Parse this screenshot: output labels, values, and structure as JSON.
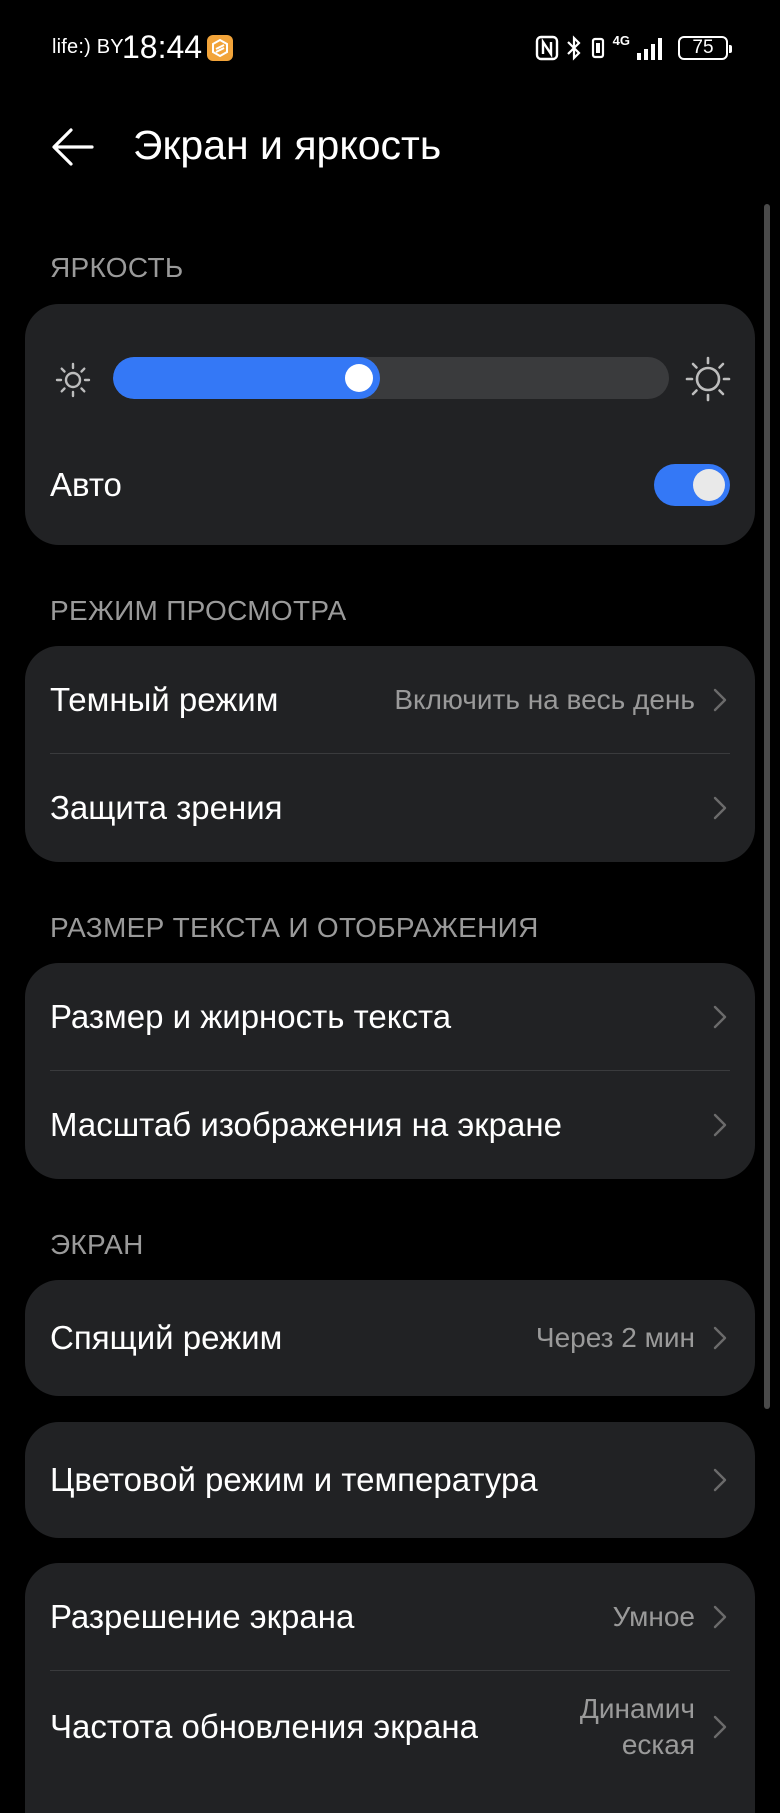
{
  "status_bar": {
    "carrier": "life:) BY",
    "time": "18:44",
    "network": "4G",
    "battery": "75"
  },
  "header": {
    "title": "Экран и яркость"
  },
  "brightness": {
    "section_title": "ЯРКОСТЬ",
    "level_percent": 48,
    "auto_label": "Авто",
    "auto_enabled": true
  },
  "view_mode": {
    "section_title": "РЕЖИМ ПРОСМОТРА",
    "items": [
      {
        "label": "Темный режим",
        "value": "Включить на весь день"
      },
      {
        "label": "Защита зрения",
        "value": ""
      }
    ]
  },
  "text_display": {
    "section_title": "РАЗМЕР ТЕКСТА И ОТОБРАЖЕНИЯ",
    "items": [
      {
        "label": "Размер и жирность текста"
      },
      {
        "label": "Масштаб изображения на экране"
      }
    ]
  },
  "screen": {
    "section_title": "ЭКРАН",
    "sleep": {
      "label": "Спящий режим",
      "value": "Через 2 мин"
    },
    "color": {
      "label": "Цветовой режим и температура"
    },
    "resolution": {
      "label": "Разрешение экрана",
      "value": "Умное"
    },
    "refresh": {
      "label": "Частота обновления экрана",
      "value": "Динамическая"
    }
  },
  "colors": {
    "accent": "#3478f6",
    "card_bg": "#212224",
    "page_bg": "#000000",
    "secondary_text": "#9a9a9a"
  }
}
